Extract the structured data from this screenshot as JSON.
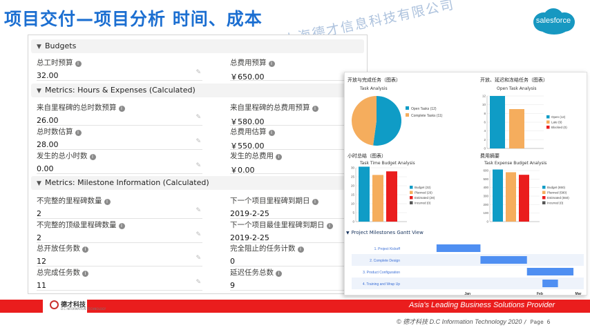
{
  "slide": {
    "title": "项目交付—项目分析 时间、成本",
    "watermark": "上海德才信息科技有限公司",
    "logo_text": "salesforce"
  },
  "record": {
    "budgets": {
      "title": "Budgets",
      "fields": [
        {
          "label": "总工时预算",
          "value": "32.00"
        },
        {
          "label": "总费用预算",
          "value": "￥650.00"
        }
      ]
    },
    "hours_expenses": {
      "title": "Metrics: Hours & Expenses (Calculated)",
      "fields": [
        {
          "label": "来自里程碑的总时数预算",
          "value": "26.00"
        },
        {
          "label": "来自里程碑的总费用预算",
          "value": "￥580.00"
        },
        {
          "label": "总时数估算",
          "value": "28.00"
        },
        {
          "label": "总费用估算",
          "value": "￥550.00"
        },
        {
          "label": "发生的总小时数",
          "value": "0.00"
        },
        {
          "label": "发生的总费用",
          "value": "￥0.00"
        }
      ]
    },
    "milestone_info": {
      "title": "Metrics: Milestone Information (Calculated)",
      "fields": [
        {
          "label": "不完整的里程碑数量",
          "value": "2"
        },
        {
          "label": "下一个项目里程碑到期日",
          "value": "2019-2-25"
        },
        {
          "label": "不完整的顶级里程碑数量",
          "value": "2"
        },
        {
          "label": "下一个项目最佳里程碑到期日",
          "value": "2019-2-25"
        },
        {
          "label": "总开放任务数",
          "value": "12"
        },
        {
          "label": "完全阻止的任务计数",
          "value": "0"
        },
        {
          "label": "总完成任务数",
          "value": "11"
        },
        {
          "label": "延迟任务总数",
          "value": "9"
        }
      ]
    }
  },
  "dashboard": {
    "gantt_header": "Project Milestones Gantt View"
  },
  "chart_data": [
    {
      "type": "pie",
      "card_title": "开放与完成任务（图表）",
      "title": "Task Analysis",
      "categories": [
        "Open Tasks (12)",
        "Complete Tasks (11)"
      ],
      "values": [
        12,
        11
      ],
      "colors": [
        "#0f9cc6",
        "#f5ad5d"
      ],
      "legend": "right"
    },
    {
      "type": "bar",
      "card_title": "开放、延迟和冻结任务（图表）",
      "title": "Open Task Analysis",
      "categories": [
        "Open (12)",
        "Late (9)",
        "Blocked (0)"
      ],
      "values": [
        12,
        9,
        0
      ],
      "colors": [
        "#0f9cc6",
        "#f5ad5d",
        "#ea1d1d"
      ],
      "ylim": [
        0,
        12
      ],
      "yticks": [
        0,
        2,
        4,
        6,
        8,
        10,
        12
      ],
      "legend": "right"
    },
    {
      "type": "bar",
      "card_title": "小时总结（图表）",
      "title": "Task Time Budget Analysis",
      "categories": [
        "Budget (32)",
        "Planned (26)",
        "Estimated (28)",
        "Incurred (0)"
      ],
      "values": [
        32,
        26,
        28,
        0
      ],
      "colors": [
        "#0f9cc6",
        "#f5ad5d",
        "#ea1d1d",
        "#555555"
      ],
      "ylim": [
        0,
        30
      ],
      "yticks": [
        0,
        5,
        10,
        15,
        20,
        25,
        30
      ],
      "legend": "right"
    },
    {
      "type": "bar",
      "card_title": "费用摘要",
      "title": "Task Expense Budget Analysis",
      "categories": [
        "Budget (650)",
        "Planned (580)",
        "Estimated (550)",
        "Incurred (0)"
      ],
      "values": [
        650,
        580,
        550,
        0
      ],
      "colors": [
        "#0f9cc6",
        "#f5ad5d",
        "#ea1d1d",
        "#555555"
      ],
      "ylim": [
        0,
        600
      ],
      "yticks": [
        0,
        100,
        200,
        300,
        400,
        500,
        600
      ],
      "legend": "right"
    },
    {
      "type": "gantt",
      "tasks": [
        {
          "label": "1. Project Kickoff",
          "start": "2019-01-03",
          "end": "2019-01-20"
        },
        {
          "label": "2. Complete Design",
          "start": "2019-01-20",
          "end": "2019-02-07"
        },
        {
          "label": "3. Product Configuration",
          "start": "2019-02-07",
          "end": "2019-02-25"
        },
        {
          "label": "4. Training and Wrap Up",
          "start": "2019-02-13",
          "end": "2019-02-19"
        }
      ],
      "x_ticks": [
        "Jan",
        "Feb",
        "Mar"
      ],
      "bar_color": "#4f8ff2"
    }
  ],
  "footer": {
    "company_name": "德才科技",
    "company_sub": "D.C INFORMATION TECHNOLOGY",
    "tagline": "Asia's Leading Business Solutions Provider",
    "copyright": "© 德才科技 D.C  Information Technology 2020",
    "page": "/ Page 6"
  }
}
